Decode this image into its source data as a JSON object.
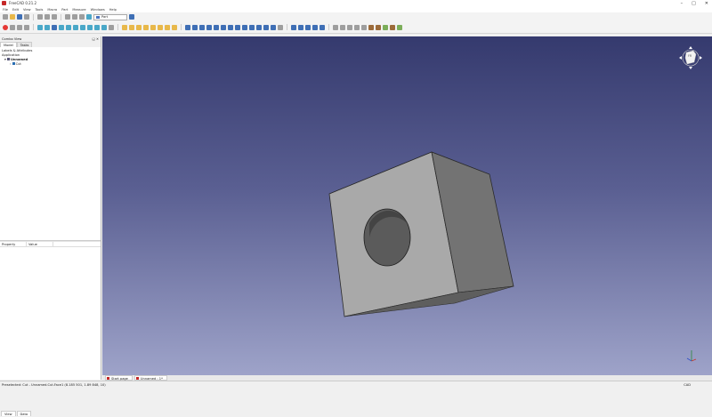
{
  "window": {
    "title": "FreeCAD 0.21.2"
  },
  "menu": [
    "File",
    "Edit",
    "View",
    "Tools",
    "Macro",
    "Part",
    "Measure",
    "Windows",
    "Help"
  ],
  "toolbar": {
    "workbench": "Part"
  },
  "combo_view": {
    "title": "Combo View",
    "tabs": [
      "Model",
      "Tasks"
    ],
    "labels_header": "Labels & Attributes",
    "application": "Application",
    "document": "Unnamed",
    "object": "Cut"
  },
  "properties": {
    "col_property": "Property",
    "col_value": "Value"
  },
  "bottom_tabs": [
    "View",
    "Data"
  ],
  "document_tabs": [
    "Start page",
    "Unnamed : 1*"
  ],
  "status": {
    "message": "Preselected: Cut - Unnamed.Cut.Face1 (8.185 501, 1.89 848, 10)",
    "nav_style": "CAD"
  },
  "colors": {
    "bg_top": "#353a6e",
    "bg_bottom": "#9ea3c9",
    "part": "#a8a8a8"
  }
}
